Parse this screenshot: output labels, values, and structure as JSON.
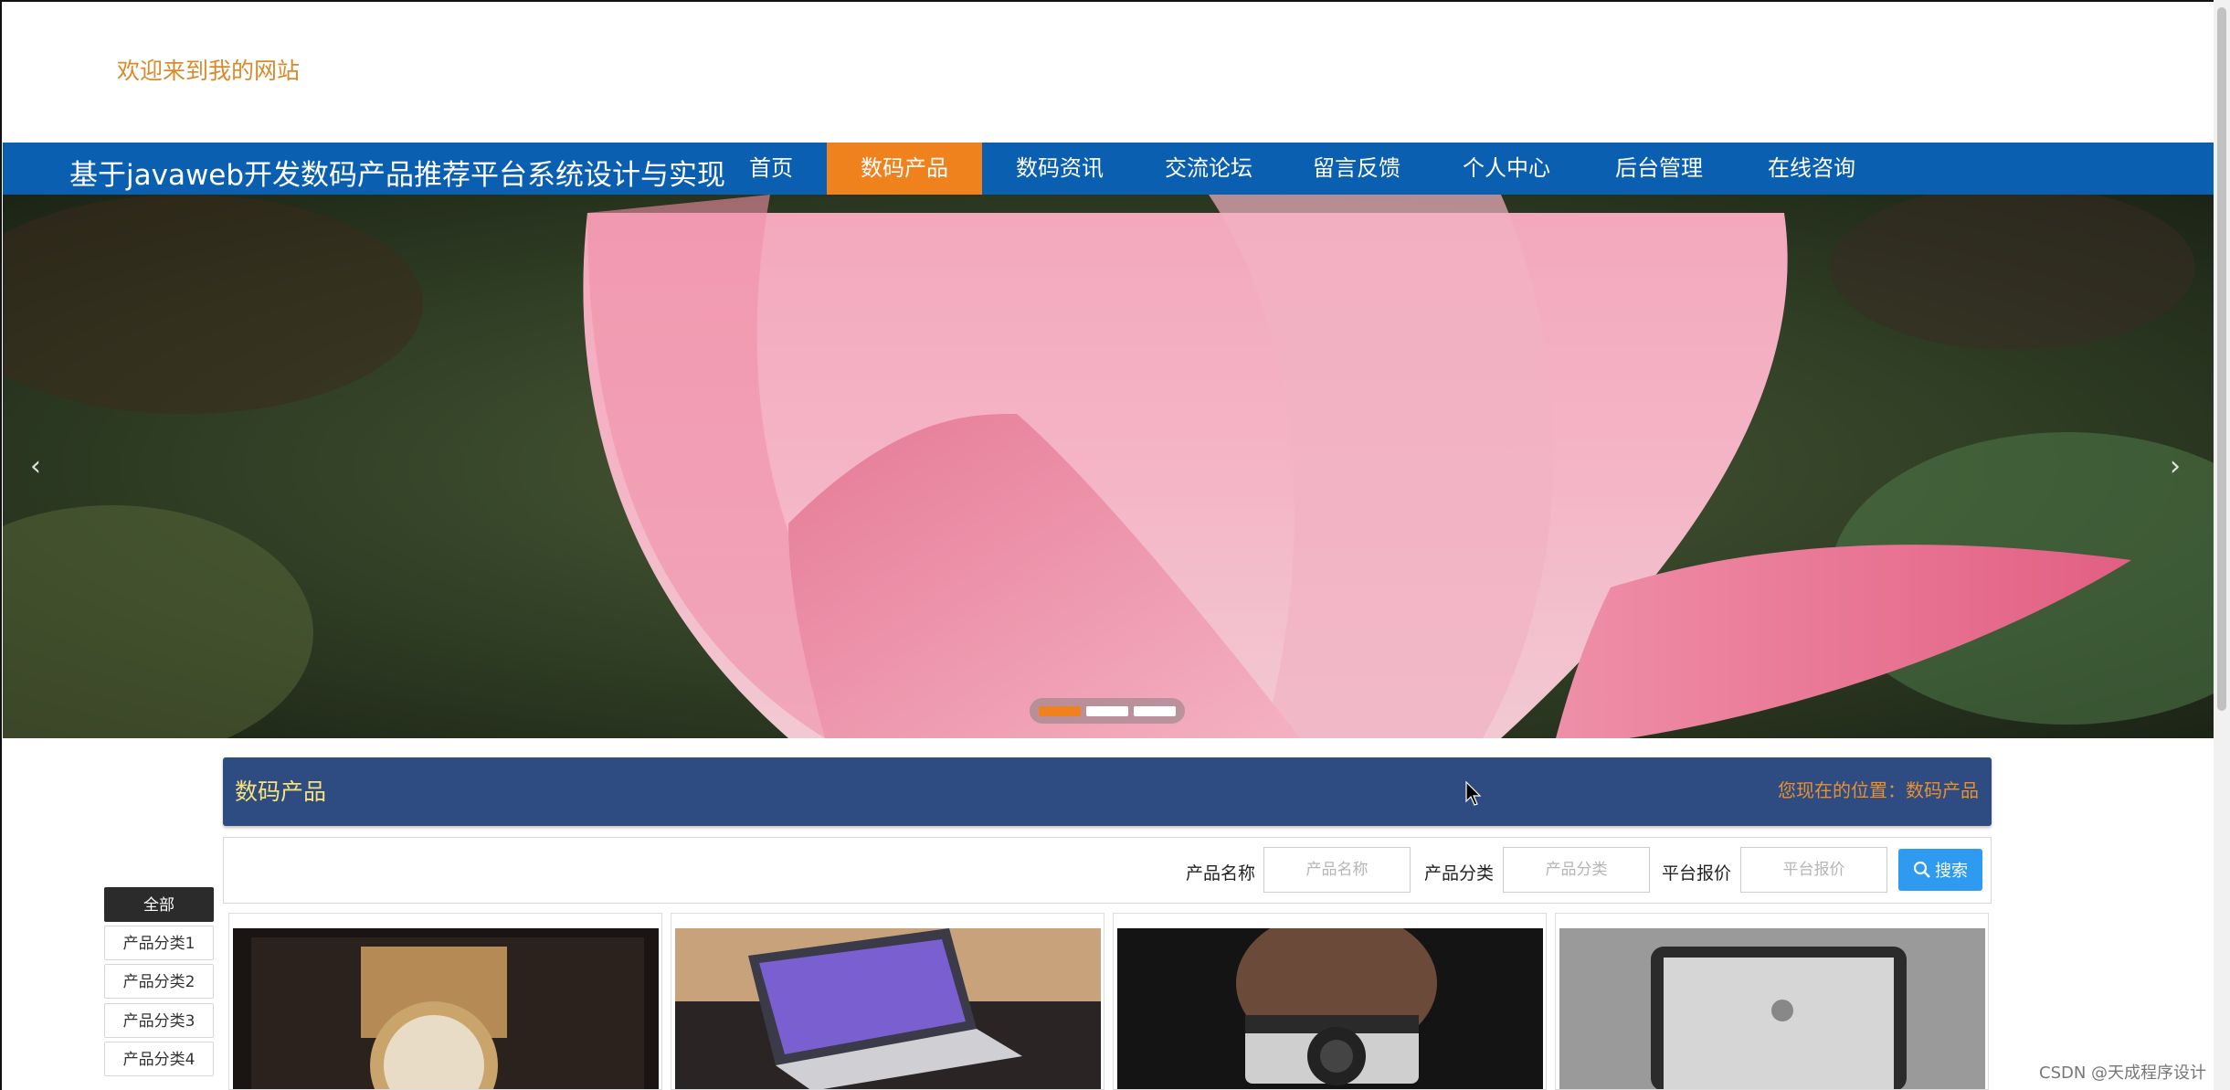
{
  "header": {
    "welcome": "欢迎来到我的网站"
  },
  "nav": {
    "site_title": "基于javaweb开发数码产品推荐平台系统设计与实现",
    "items": [
      {
        "label": "首页"
      },
      {
        "label": "数码产品",
        "active": true
      },
      {
        "label": "数码资讯"
      },
      {
        "label": "交流论坛"
      },
      {
        "label": "留言反馈"
      },
      {
        "label": "个人中心"
      },
      {
        "label": "后台管理"
      },
      {
        "label": "在线咨询"
      }
    ],
    "active_color": "#f0821e",
    "bar_color": "#0b5fb0"
  },
  "banner": {
    "prev_icon": "‹",
    "next_icon": "›",
    "slide_count": 3,
    "active_slide": 1
  },
  "section": {
    "title": "数码产品",
    "location_prefix": "您现在的位置：",
    "location_current": "数码产品"
  },
  "search": {
    "fields": [
      {
        "label": "产品名称",
        "placeholder": "产品名称"
      },
      {
        "label": "产品分类",
        "placeholder": "产品分类"
      },
      {
        "label": "平台报价",
        "placeholder": "平台报价"
      }
    ],
    "button_label": "搜索",
    "button_color": "#2f9bf0"
  },
  "categories": [
    {
      "label": "全部",
      "active": true
    },
    {
      "label": "产品分类1"
    },
    {
      "label": "产品分类2"
    },
    {
      "label": "产品分类3"
    },
    {
      "label": "产品分类4"
    }
  ],
  "products": [
    {
      "image": "watch"
    },
    {
      "image": "laptop"
    },
    {
      "image": "camera"
    },
    {
      "image": "tablet"
    }
  ],
  "watermark": "CSDN @天成程序设计"
}
